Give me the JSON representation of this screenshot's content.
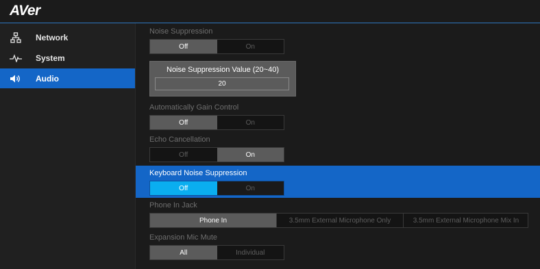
{
  "brand": {
    "logo_text": "AVer"
  },
  "sidebar": {
    "items": [
      {
        "label": "Network",
        "icon": "network-icon",
        "active": false
      },
      {
        "label": "System",
        "icon": "pulse-icon",
        "active": false
      },
      {
        "label": "Audio",
        "icon": "speaker-icon",
        "active": true
      }
    ]
  },
  "settings": {
    "noise_suppression": {
      "label": "Noise Suppression",
      "options": [
        "Off",
        "On"
      ],
      "selected": "Off"
    },
    "noise_suppression_value": {
      "label": "Noise Suppression Value (20~40)",
      "value": "20"
    },
    "agc": {
      "label": "Automatically Gain Control",
      "options": [
        "Off",
        "On"
      ],
      "selected": "Off"
    },
    "echo": {
      "label": "Echo Cancellation",
      "options": [
        "Off",
        "On"
      ],
      "selected": "On"
    },
    "keyboard_ns": {
      "label": "Keyboard Noise Suppression",
      "options": [
        "Off",
        "On"
      ],
      "selected": "Off"
    },
    "phone_jack": {
      "label": "Phone In Jack",
      "options": [
        "Phone In",
        "3.5mm External Microphone Only",
        "3.5mm External Microphone Mix In"
      ],
      "selected": "Phone In"
    },
    "exp_mic_mute": {
      "label": "Expansion Mic Mute",
      "options": [
        "All",
        "Individual"
      ],
      "selected": "All"
    }
  },
  "colors": {
    "accent_blue": "#1466c7",
    "toggle_on_blue": "#0aaef0",
    "selected_gray": "#5b5b5b",
    "background": "#1b1b1b"
  }
}
